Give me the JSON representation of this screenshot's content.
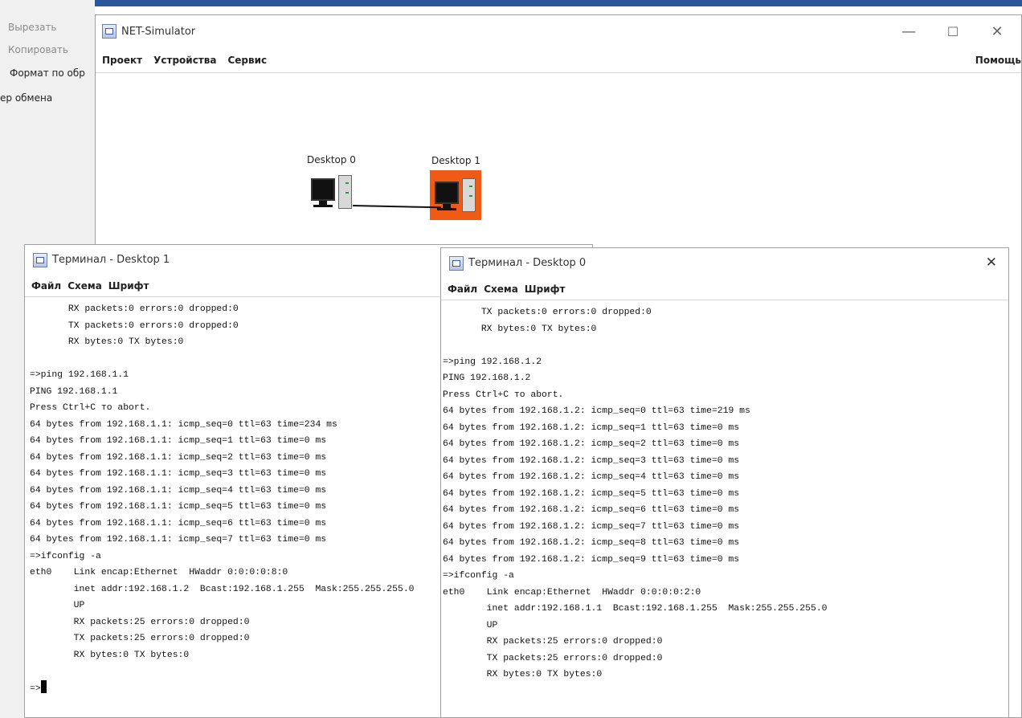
{
  "background_app": {
    "items": [
      "Вырезать",
      "Копировать",
      "Формат по обр",
      "ер обмена"
    ]
  },
  "main_window": {
    "title": "NET-Simulator",
    "menu": [
      "Проект",
      "Устройства",
      "Сервис"
    ],
    "help_menu": "Помощь",
    "controls": {
      "minimize": "—",
      "maximize": "☐",
      "close": "✕"
    }
  },
  "devices": [
    {
      "label": "Desktop 0",
      "highlighted": false
    },
    {
      "label": "Desktop 1",
      "highlighted": true,
      "highlight_color": "#ef5b14"
    }
  ],
  "terminal_desktop1": {
    "title": "Терминал - Desktop 1",
    "menu": [
      "Файл",
      "Схема",
      "Шрифт"
    ],
    "lines": [
      "       RX packets:0 errors:0 dropped:0",
      "       TX packets:0 errors:0 dropped:0",
      "       RX bytes:0 TX bytes:0",
      "",
      "=>ping 192.168.1.1",
      "PING 192.168.1.1",
      "Press Ctrl+C то abort.",
      "64 bytes from 192.168.1.1: icmp_seq=0 ttl=63 time=234 ms",
      "64 bytes from 192.168.1.1: icmp_seq=1 ttl=63 time=0 ms",
      "64 bytes from 192.168.1.1: icmp_seq=2 ttl=63 time=0 ms",
      "64 bytes from 192.168.1.1: icmp_seq=3 ttl=63 time=0 ms",
      "64 bytes from 192.168.1.1: icmp_seq=4 ttl=63 time=0 ms",
      "64 bytes from 192.168.1.1: icmp_seq=5 ttl=63 time=0 ms",
      "64 bytes from 192.168.1.1: icmp_seq=6 ttl=63 time=0 ms",
      "64 bytes from 192.168.1.1: icmp_seq=7 ttl=63 time=0 ms",
      "=>ifconfig -a",
      "eth0    Link encap:Ethernet  HWaddr 0:0:0:0:8:0",
      "        inet addr:192.168.1.2  Bcast:192.168.1.255  Mask:255.255.255.0",
      "        UP",
      "        RX packets:25 errors:0 dropped:0",
      "        TX packets:25 errors:0 dropped:0",
      "        RX bytes:0 TX bytes:0",
      ""
    ],
    "prompt": "=>"
  },
  "terminal_desktop0": {
    "title": "Терминал - Desktop 0",
    "menu": [
      "Файл",
      "Схема",
      "Шрифт"
    ],
    "close": "✕",
    "lines": [
      "       TX packets:0 errors:0 dropped:0",
      "       RX bytes:0 TX bytes:0",
      "",
      "=>ping 192.168.1.2",
      "PING 192.168.1.2",
      "Press Ctrl+C то abort.",
      "64 bytes from 192.168.1.2: icmp_seq=0 ttl=63 time=219 ms",
      "64 bytes from 192.168.1.2: icmp_seq=1 ttl=63 time=0 ms",
      "64 bytes from 192.168.1.2: icmp_seq=2 ttl=63 time=0 ms",
      "64 bytes from 192.168.1.2: icmp_seq=3 ttl=63 time=0 ms",
      "64 bytes from 192.168.1.2: icmp_seq=4 ttl=63 time=0 ms",
      "64 bytes from 192.168.1.2: icmp_seq=5 ttl=63 time=0 ms",
      "64 bytes from 192.168.1.2: icmp_seq=6 ttl=63 time=0 ms",
      "64 bytes from 192.168.1.2: icmp_seq=7 ttl=63 time=0 ms",
      "64 bytes from 192.168.1.2: icmp_seq=8 ttl=63 time=0 ms",
      "64 bytes from 192.168.1.2: icmp_seq=9 ttl=63 time=0 ms",
      "=>ifconfig -a",
      "eth0    Link encap:Ethernet  HWaddr 0:0:0:0:2:0",
      "        inet addr:192.168.1.1  Bcast:192.168.1.255  Mask:255.255.255.0",
      "        UP",
      "        RX packets:25 errors:0 dropped:0",
      "        TX packets:25 errors:0 dropped:0",
      "        RX bytes:0 TX bytes:0"
    ]
  }
}
